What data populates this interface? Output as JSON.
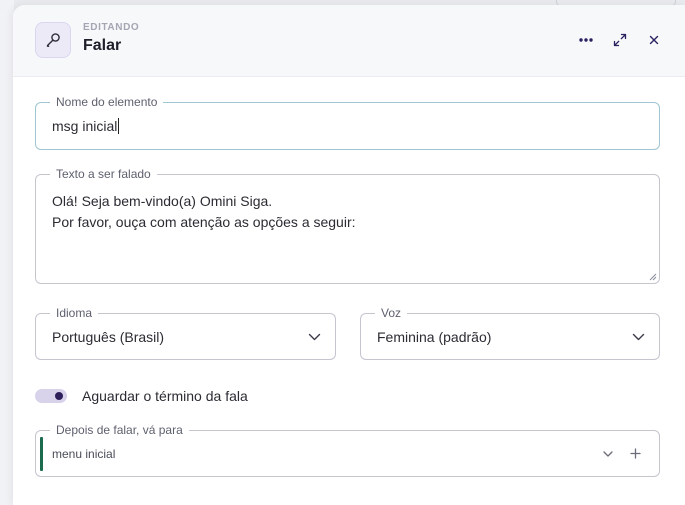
{
  "header": {
    "eyebrow": "EDITANDO",
    "title": "Falar",
    "icon": "microphone-icon",
    "actions": [
      "more-icon",
      "expand-icon",
      "close-icon"
    ]
  },
  "form": {
    "element_name": {
      "label": "Nome do elemento",
      "value": "msg inicial"
    },
    "speech_text": {
      "label": "Texto a ser falado",
      "line1": "Olá! Seja bem-vindo(a) Omini Siga.",
      "line2": "Por favor, ouça com atenção as opções a seguir:"
    },
    "language": {
      "label": "Idioma",
      "value": "Português (Brasil)"
    },
    "voice": {
      "label": "Voz",
      "value": "Feminina (padrão)"
    },
    "wait_toggle": {
      "label": "Aguardar o término da fala",
      "checked": true
    },
    "after_speak": {
      "label": "Depois de falar, vá para",
      "value": "menu inicial"
    }
  },
  "colors": {
    "accent": "#2d1f5a",
    "toggle_track": "#d8d2ea",
    "focus_border": "#9fc6d2",
    "selection_bar": "#1d6b4f"
  }
}
